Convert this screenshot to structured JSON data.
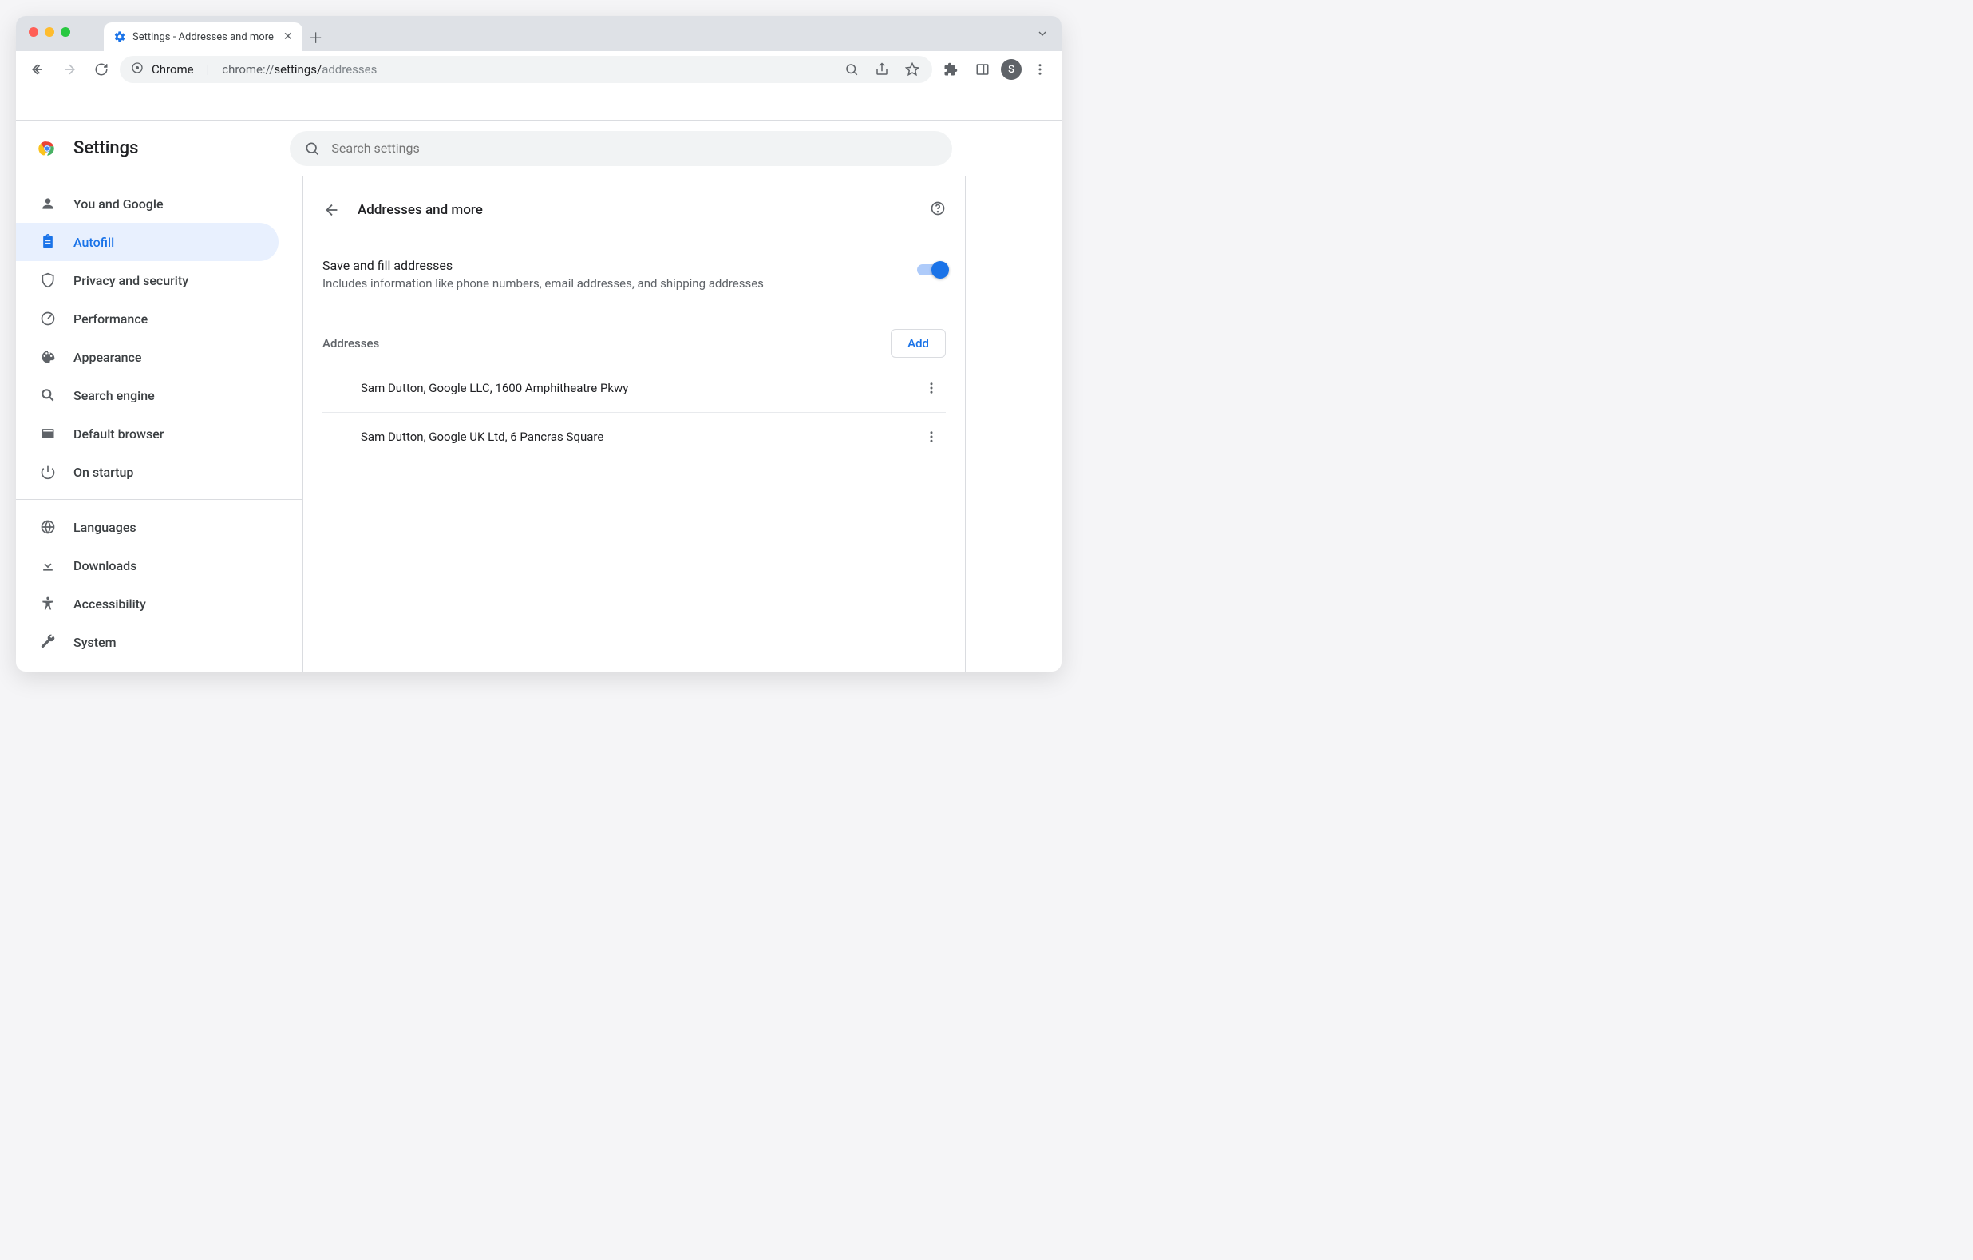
{
  "browser": {
    "tab_title": "Settings - Addresses and more",
    "url_prefix": "Chrome",
    "url_scheme": "chrome://",
    "url_path1": "settings/",
    "url_path2": "addresses",
    "avatar_letter": "S"
  },
  "app": {
    "title": "Settings",
    "search_placeholder": "Search settings"
  },
  "sidebar": {
    "items": [
      {
        "label": "You and Google"
      },
      {
        "label": "Autofill"
      },
      {
        "label": "Privacy and security"
      },
      {
        "label": "Performance"
      },
      {
        "label": "Appearance"
      },
      {
        "label": "Search engine"
      },
      {
        "label": "Default browser"
      },
      {
        "label": "On startup"
      }
    ],
    "items2": [
      {
        "label": "Languages"
      },
      {
        "label": "Downloads"
      },
      {
        "label": "Accessibility"
      },
      {
        "label": "System"
      }
    ]
  },
  "page": {
    "title": "Addresses and more",
    "toggle_title": "Save and fill addresses",
    "toggle_sub": "Includes information like phone numbers, email addresses, and shipping addresses",
    "section_label": "Addresses",
    "add_label": "Add",
    "rows": [
      {
        "text": "Sam Dutton, Google LLC, 1600 Amphitheatre Pkwy"
      },
      {
        "text": "Sam Dutton, Google UK Ltd, 6 Pancras Square"
      }
    ]
  }
}
